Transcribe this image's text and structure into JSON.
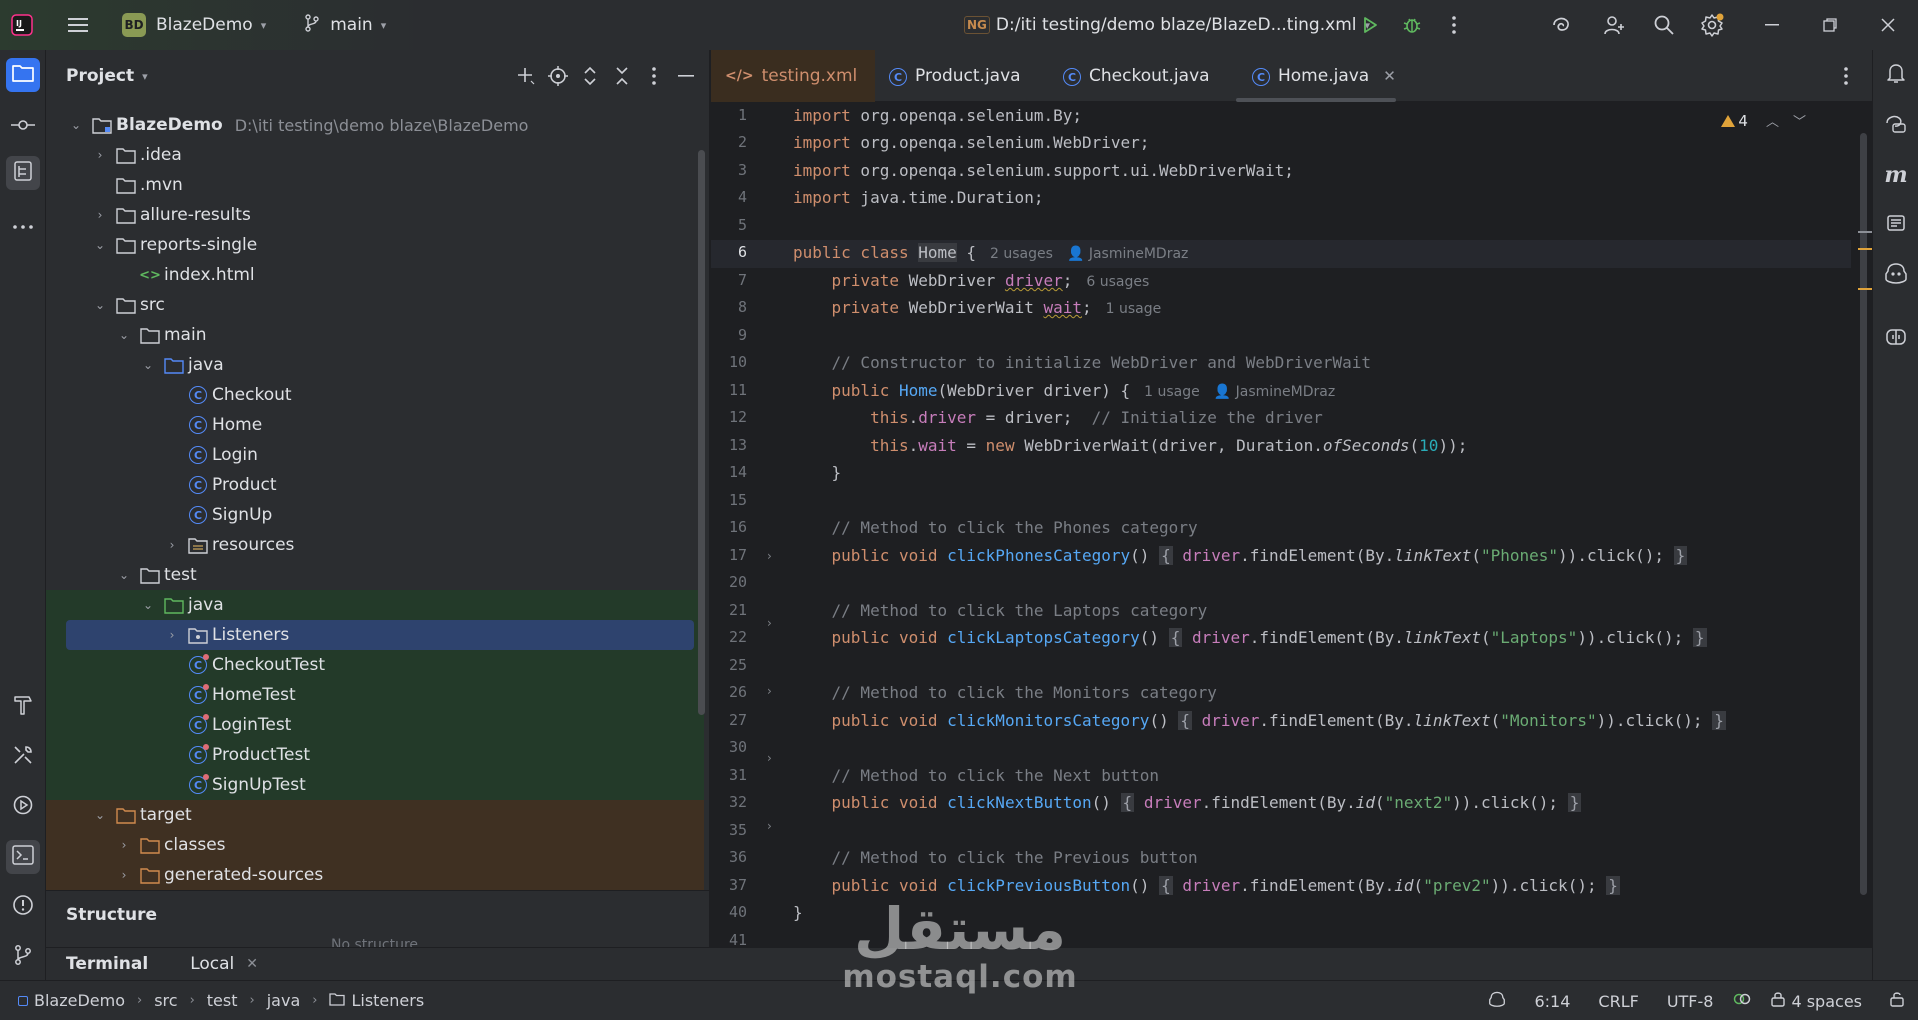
{
  "titlebar": {
    "project_badge": "BD",
    "project_name": "BlazeDemo",
    "branch": "main",
    "run_config_badge": "NG",
    "run_config": "D:/iti testing/demo blaze/BlazeD...ting.xml"
  },
  "project_panel": {
    "title": "Project",
    "root_name": "BlazeDemo",
    "root_path": "D:\\iti testing\\demo blaze\\BlazeDemo",
    "items": [
      {
        "label": "BlazeDemo",
        "kind": "module"
      },
      {
        "label": ".idea",
        "kind": "folder"
      },
      {
        "label": ".mvn",
        "kind": "folder"
      },
      {
        "label": "allure-results",
        "kind": "folder"
      },
      {
        "label": "reports-single",
        "kind": "folder"
      },
      {
        "label": "index.html",
        "kind": "html"
      },
      {
        "label": "src",
        "kind": "folder"
      },
      {
        "label": "main",
        "kind": "folder"
      },
      {
        "label": "java",
        "kind": "source-folder"
      },
      {
        "label": "Checkout",
        "kind": "class"
      },
      {
        "label": "Home",
        "kind": "class"
      },
      {
        "label": "Login",
        "kind": "class"
      },
      {
        "label": "Product",
        "kind": "class"
      },
      {
        "label": "SignUp",
        "kind": "class"
      },
      {
        "label": "resources",
        "kind": "resources-folder"
      },
      {
        "label": "test",
        "kind": "folder"
      },
      {
        "label": "java",
        "kind": "test-source-folder"
      },
      {
        "label": "Listeners",
        "kind": "package"
      },
      {
        "label": "CheckoutTest",
        "kind": "test-class"
      },
      {
        "label": "HomeTest",
        "kind": "test-class"
      },
      {
        "label": "LoginTest",
        "kind": "test-class"
      },
      {
        "label": "ProductTest",
        "kind": "test-class"
      },
      {
        "label": "SignUpTest",
        "kind": "test-class"
      },
      {
        "label": "target",
        "kind": "excluded-folder"
      },
      {
        "label": "classes",
        "kind": "excluded-folder"
      },
      {
        "label": "generated-sources",
        "kind": "excluded-folder"
      }
    ]
  },
  "structure_panel": {
    "title": "Structure",
    "empty_text": "No structure"
  },
  "terminal": {
    "title": "Terminal",
    "tab": "Local"
  },
  "tabs": [
    {
      "label": "testing.xml"
    },
    {
      "label": "Product.java"
    },
    {
      "label": "Checkout.java"
    },
    {
      "label": "Home.java",
      "active": true
    }
  ],
  "editor": {
    "warning_count": "4",
    "line_numbers": [
      "1",
      "2",
      "3",
      "4",
      "5",
      "6",
      "7",
      "8",
      "9",
      "10",
      "11",
      "12",
      "13",
      "14",
      "15",
      "16",
      "17",
      "20",
      "21",
      "22",
      "25",
      "26",
      "27",
      "30",
      "31",
      "32",
      "35",
      "36",
      "37",
      "40",
      "41"
    ],
    "code": {
      "l1_kw": "import",
      "l1_rest": " org.openqa.selenium.By;",
      "l2_kw": "import",
      "l2_rest": " org.openqa.selenium.WebDriver;",
      "l3_kw": "import",
      "l3_rest": " org.openqa.selenium.support.ui.WebDriverWait;",
      "l4_kw": "import",
      "l4_rest": " java.time.Duration;",
      "l6_kw": "public class",
      "l6_cls": "Home",
      "l6_rest": " {",
      "l6_hint": "2 usages",
      "l6_author": "JasmineMDraz",
      "l7_kw": "private",
      "l7_type": " WebDriver ",
      "l7_field": "driver",
      "l7_rest": ";",
      "l7_hint": "6 usages",
      "l8_kw": "private",
      "l8_type": " WebDriverWait ",
      "l8_field": "wait",
      "l8_rest": ";",
      "l8_hint": "1 usage",
      "l10_cmt": "// Constructor to initialize WebDriver and WebDriverWait",
      "l11_kw": "public",
      "l11_fn": "Home",
      "l11_rest": "(WebDriver driver) {",
      "l11_hint": "1 usage",
      "l11_author": "JasmineMDraz",
      "l12_kw": "this",
      "l12_field": "driver",
      "l12_rest": " = driver;",
      "l12_cmt": "// Initialize the driver",
      "l13_kw": "this",
      "l13_field": "wait",
      "l13_mid": " = ",
      "l13_new": "new",
      "l13_rest": " WebDriverWait(driver, Duration.",
      "l13_it": "ofSeconds",
      "l13_num": "10",
      "l13_end": "));",
      "l14": "}",
      "l16_cmt": "// Method to click the Phones category",
      "l17_kw": "public void",
      "l17_fn": "clickPhonesCategory",
      "l17_field": "driver",
      "l17_mid": ".findElement(By.",
      "l17_it": "linkText",
      "l17_str": "\"Phones\"",
      "l17_end": ")).click();",
      "l21_cmt": "// Method to click the Laptops category",
      "l22_kw": "public void",
      "l22_fn": "clickLaptopsCategory",
      "l22_field": "driver",
      "l22_mid": ".findElement(By.",
      "l22_it": "linkText",
      "l22_str": "\"Laptops\"",
      "l22_end": ")).click();",
      "l26_cmt": "// Method to click the Monitors category",
      "l27_kw": "public void",
      "l27_fn": "clickMonitorsCategory",
      "l27_field": "driver",
      "l27_mid": ".findElement(By.",
      "l27_it": "linkText",
      "l27_str": "\"Monitors\"",
      "l27_end": ")).click();",
      "l31_cmt": "// Method to click the Next button",
      "l32_kw": "public void",
      "l32_fn": "clickNextButton",
      "l32_field": "driver",
      "l32_mid": ".findElement(By.",
      "l32_it": "id",
      "l32_str": "\"next2\"",
      "l32_end": ")).click();",
      "l36_cmt": "// Method to click the Previous button",
      "l37_kw": "public void",
      "l37_fn": "clickPreviousButton",
      "l37_field": "driver",
      "l37_mid": ".findElement(By.",
      "l37_it": "id",
      "l37_str": "\"prev2\"",
      "l37_end": ")).click();",
      "l40": "}"
    }
  },
  "statusbar": {
    "breadcrumb": [
      "BlazeDemo",
      "src",
      "test",
      "java",
      "Listeners"
    ],
    "position": "6:14",
    "line_separator": "CRLF",
    "encoding": "UTF-8",
    "indent": "4 spaces"
  },
  "watermark": {
    "arabic": "مستقل",
    "latin": "mostaql.com"
  },
  "colors": {
    "accent": "#3574f0",
    "keyword": "#cf8e6d",
    "function": "#56a8f5",
    "field": "#c77dbb",
    "string": "#6aab73",
    "comment": "#7a7e85",
    "test_green_bg": "#233a29",
    "excluded_orange_bg": "#3f3022",
    "warning": "#e0a33a"
  },
  "icons": [
    "main-menu-icon",
    "branch-icon",
    "run-icon",
    "debug-icon",
    "more-vertical-icon",
    "ai-assistant-icon",
    "add-user-icon",
    "search-icon",
    "settings-icon",
    "minimize-icon",
    "restore-icon",
    "close-icon",
    "folder-icon",
    "commit-icon",
    "structure-icon",
    "more-horizontal-icon",
    "build-icon",
    "tools-icon",
    "services-icon",
    "terminal-icon",
    "problems-icon",
    "git-icon",
    "notifications-icon",
    "copilot-icon"
  ]
}
